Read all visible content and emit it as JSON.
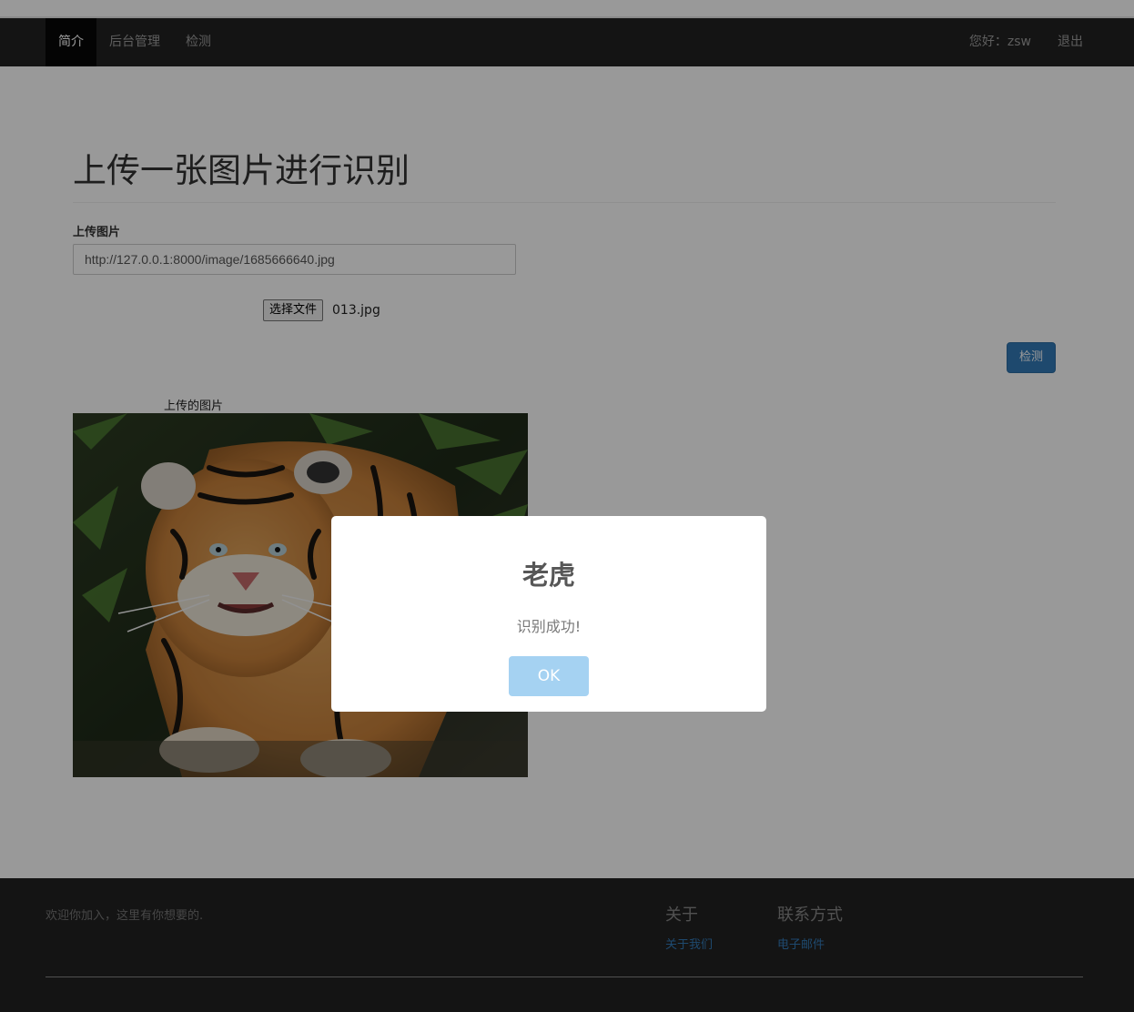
{
  "navbar": {
    "items": [
      {
        "label": "简介"
      },
      {
        "label": "后台管理"
      },
      {
        "label": "检测"
      }
    ],
    "greeting": "您好：zsw",
    "logout": "退出"
  },
  "main": {
    "title": "上传一张图片进行识别",
    "upload_label": "上传图片",
    "url_value": "http://127.0.0.1:8000/image/1685666640.jpg",
    "file_button": "选择文件",
    "file_name": "013.jpg",
    "detect_button": "检测",
    "image_caption": "上传的图片"
  },
  "footer": {
    "text": "欢迎你加入，这里有你想要的.",
    "about": {
      "heading": "关于",
      "link": "关于我们"
    },
    "contact": {
      "heading": "联系方式",
      "link": "电子邮件"
    }
  },
  "modal": {
    "title": "老虎",
    "message": "识别成功!",
    "ok": "OK"
  },
  "colors": {
    "navbar": "#222222",
    "primary": "#337ab7",
    "ok_button": "#a5d2f2"
  }
}
